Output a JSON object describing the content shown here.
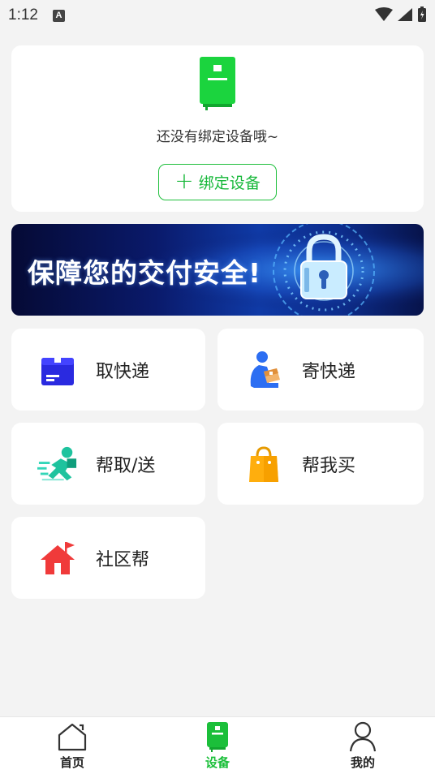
{
  "status_bar": {
    "time": "1:12",
    "badge": "A"
  },
  "device_card": {
    "icon": "device-icon",
    "empty_text": "还没有绑定设备哦~",
    "bind_button": {
      "icon": "plus-icon",
      "plus": "+",
      "label": "绑定设备"
    }
  },
  "banner": {
    "text": "保障您的交付安全!",
    "icon": "padlock-icon"
  },
  "services": [
    {
      "label": "取快递",
      "icon": "parcel-box-icon"
    },
    {
      "label": "寄快递",
      "icon": "courier-person-icon"
    },
    {
      "label": "帮取/送",
      "icon": "running-delivery-icon"
    },
    {
      "label": "帮我买",
      "icon": "shopping-bag-icon"
    },
    {
      "label": "社区帮",
      "icon": "house-icon"
    }
  ],
  "bottom_nav": [
    {
      "label": "首页",
      "icon": "home-icon",
      "active": false
    },
    {
      "label": "设备",
      "icon": "device-icon",
      "active": true
    },
    {
      "label": "我的",
      "icon": "person-icon",
      "active": false
    }
  ],
  "colors": {
    "accent_green": "#1bbf3a",
    "background": "#f3f3f3",
    "card": "#ffffff"
  }
}
